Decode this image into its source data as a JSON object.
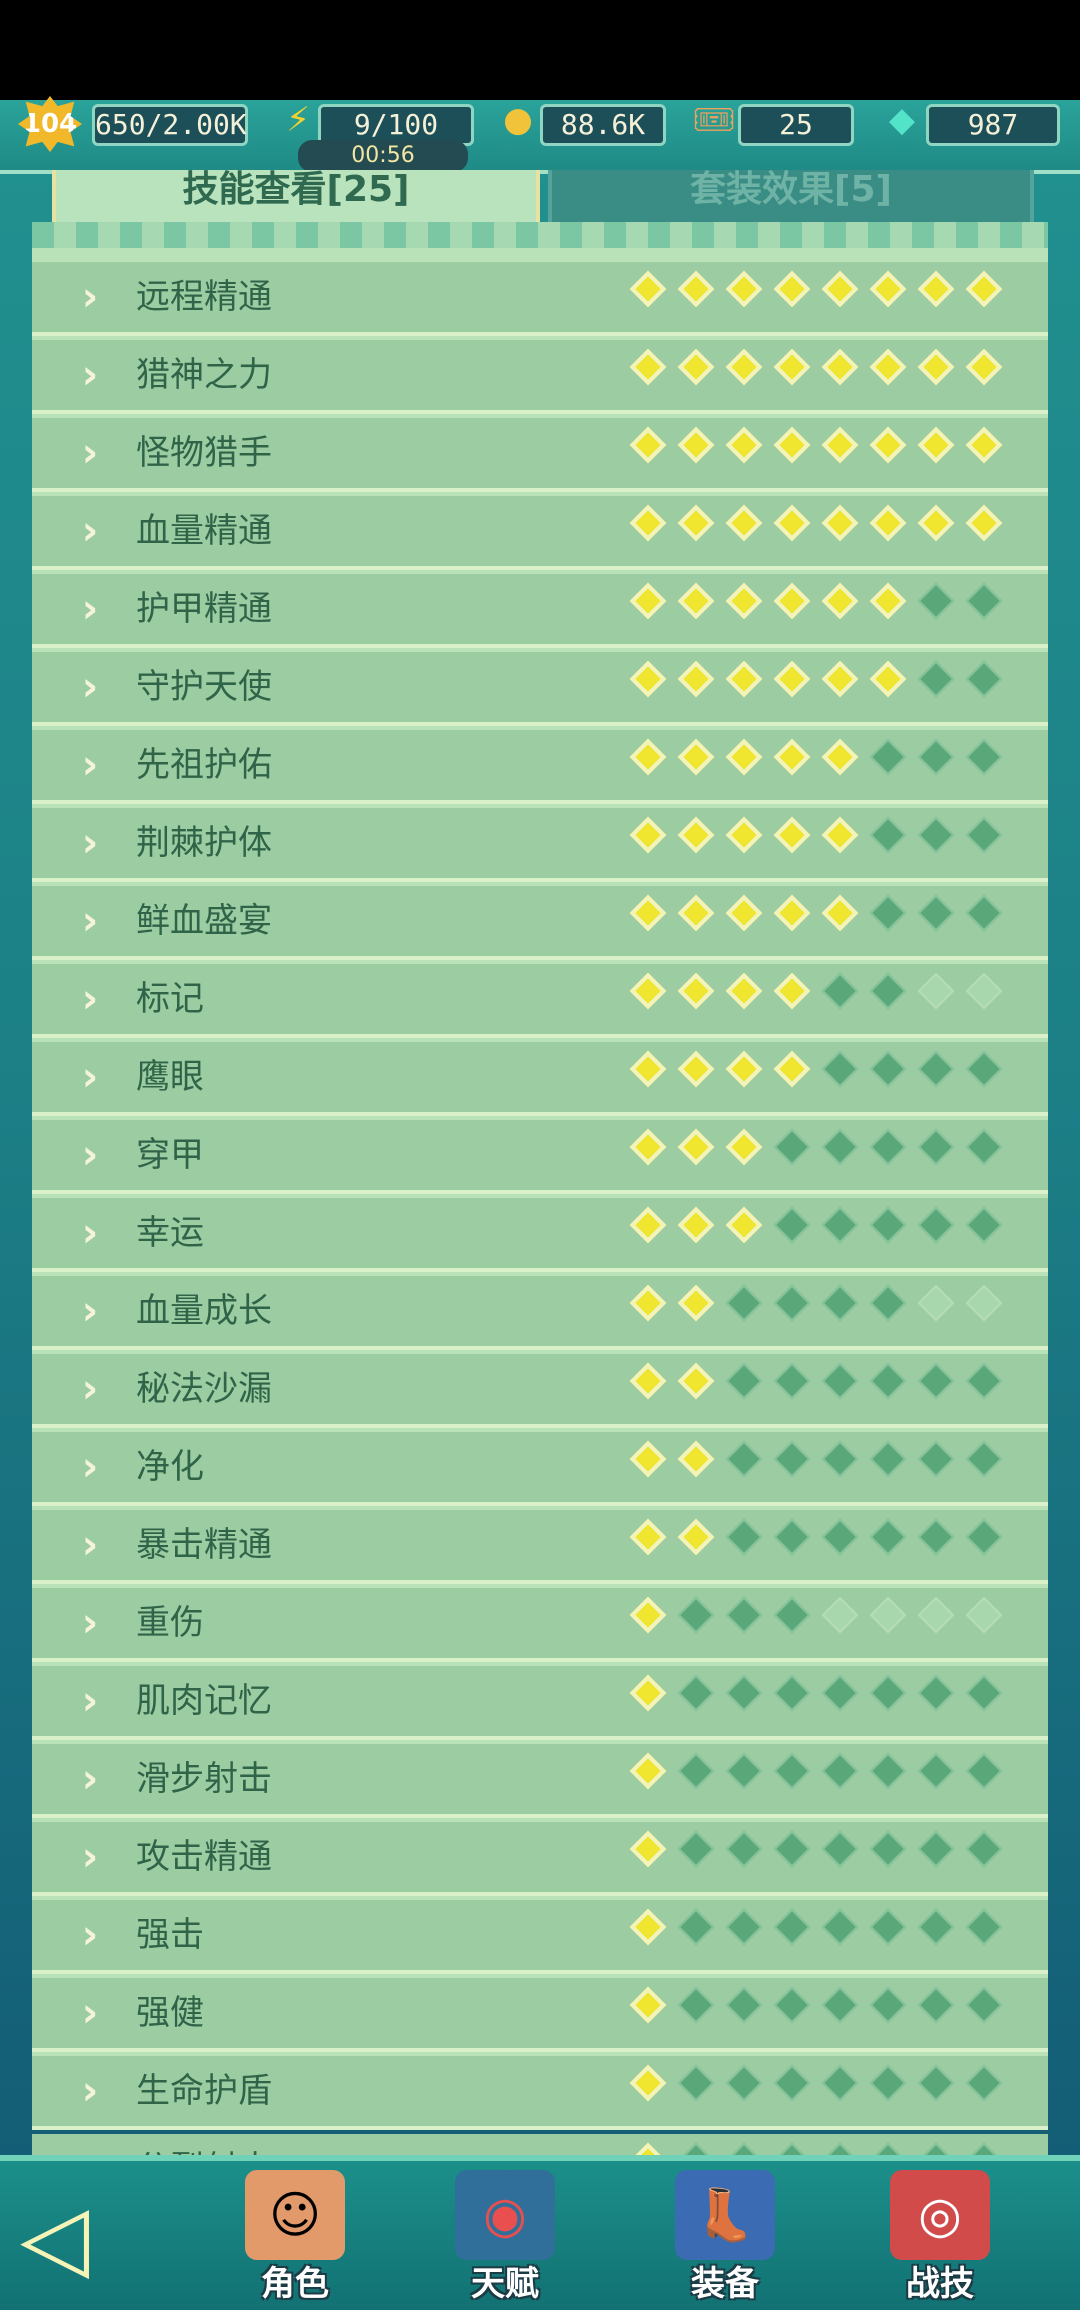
{
  "hud": {
    "level": "104",
    "exp": "650/2.00K",
    "energy": "9/100",
    "energy_timer": "00:56",
    "gold": "88.6K",
    "tickets": "25",
    "gems": "987"
  },
  "tabs": {
    "active_label": "技能查看[25]",
    "inactive_label": "套装效果[5]"
  },
  "skills": [
    {
      "name": "远程精通",
      "levels": [
        "on",
        "on",
        "on",
        "on",
        "on",
        "on",
        "on",
        "on"
      ]
    },
    {
      "name": "猎神之力",
      "levels": [
        "on",
        "on",
        "on",
        "on",
        "on",
        "on",
        "on",
        "on"
      ]
    },
    {
      "name": "怪物猎手",
      "levels": [
        "on",
        "on",
        "on",
        "on",
        "on",
        "on",
        "on",
        "on"
      ]
    },
    {
      "name": "血量精通",
      "levels": [
        "on",
        "on",
        "on",
        "on",
        "on",
        "on",
        "on",
        "on"
      ]
    },
    {
      "name": "护甲精通",
      "levels": [
        "on",
        "on",
        "on",
        "on",
        "on",
        "on",
        "off",
        "off"
      ]
    },
    {
      "name": "守护天使",
      "levels": [
        "on",
        "on",
        "on",
        "on",
        "on",
        "on",
        "off",
        "off"
      ]
    },
    {
      "name": "先祖护佑",
      "levels": [
        "on",
        "on",
        "on",
        "on",
        "on",
        "off",
        "off",
        "off"
      ]
    },
    {
      "name": "荆棘护体",
      "levels": [
        "on",
        "on",
        "on",
        "on",
        "on",
        "off",
        "off",
        "off"
      ]
    },
    {
      "name": "鲜血盛宴",
      "levels": [
        "on",
        "on",
        "on",
        "on",
        "on",
        "off",
        "off",
        "off"
      ]
    },
    {
      "name": "标记",
      "levels": [
        "on",
        "on",
        "on",
        "on",
        "off",
        "off",
        "dim",
        "dim"
      ]
    },
    {
      "name": "鹰眼",
      "levels": [
        "on",
        "on",
        "on",
        "on",
        "off",
        "off",
        "off",
        "off"
      ]
    },
    {
      "name": "穿甲",
      "levels": [
        "on",
        "on",
        "on",
        "off",
        "off",
        "off",
        "off",
        "off"
      ]
    },
    {
      "name": "幸运",
      "levels": [
        "on",
        "on",
        "on",
        "off",
        "off",
        "off",
        "off",
        "off"
      ]
    },
    {
      "name": "血量成长",
      "levels": [
        "on",
        "on",
        "off",
        "off",
        "off",
        "off",
        "dim",
        "dim"
      ]
    },
    {
      "name": "秘法沙漏",
      "levels": [
        "on",
        "on",
        "off",
        "off",
        "off",
        "off",
        "off",
        "off"
      ]
    },
    {
      "name": "净化",
      "levels": [
        "on",
        "on",
        "off",
        "off",
        "off",
        "off",
        "off",
        "off"
      ]
    },
    {
      "name": "暴击精通",
      "levels": [
        "on",
        "on",
        "off",
        "off",
        "off",
        "off",
        "off",
        "off"
      ]
    },
    {
      "name": "重伤",
      "levels": [
        "on",
        "off",
        "off",
        "off",
        "dim",
        "dim",
        "dim",
        "dim"
      ]
    },
    {
      "name": "肌肉记忆",
      "levels": [
        "on",
        "off",
        "off",
        "off",
        "off",
        "off",
        "off",
        "off"
      ]
    },
    {
      "name": "滑步射击",
      "levels": [
        "on",
        "off",
        "off",
        "off",
        "off",
        "off",
        "off",
        "off"
      ]
    },
    {
      "name": "攻击精通",
      "levels": [
        "on",
        "off",
        "off",
        "off",
        "off",
        "off",
        "off",
        "off"
      ]
    },
    {
      "name": "强击",
      "levels": [
        "on",
        "off",
        "off",
        "off",
        "off",
        "off",
        "off",
        "off"
      ]
    },
    {
      "name": "强健",
      "levels": [
        "on",
        "off",
        "off",
        "off",
        "off",
        "off",
        "off",
        "off"
      ]
    },
    {
      "name": "生命护盾",
      "levels": [
        "on",
        "off",
        "off",
        "off",
        "off",
        "off",
        "off",
        "off"
      ]
    },
    {
      "name": "分裂射击",
      "levels": [
        "on",
        "off",
        "off",
        "off",
        "off",
        "off",
        "off",
        "off"
      ]
    }
  ],
  "nav": {
    "role": "角色",
    "talent": "天赋",
    "equip": "装备",
    "combat": "战技"
  },
  "colors": {
    "gem_on": "#f0e62f",
    "gem_off": "#5aa77a",
    "panel": "#b9e2b9",
    "row": "#9ccda2"
  }
}
